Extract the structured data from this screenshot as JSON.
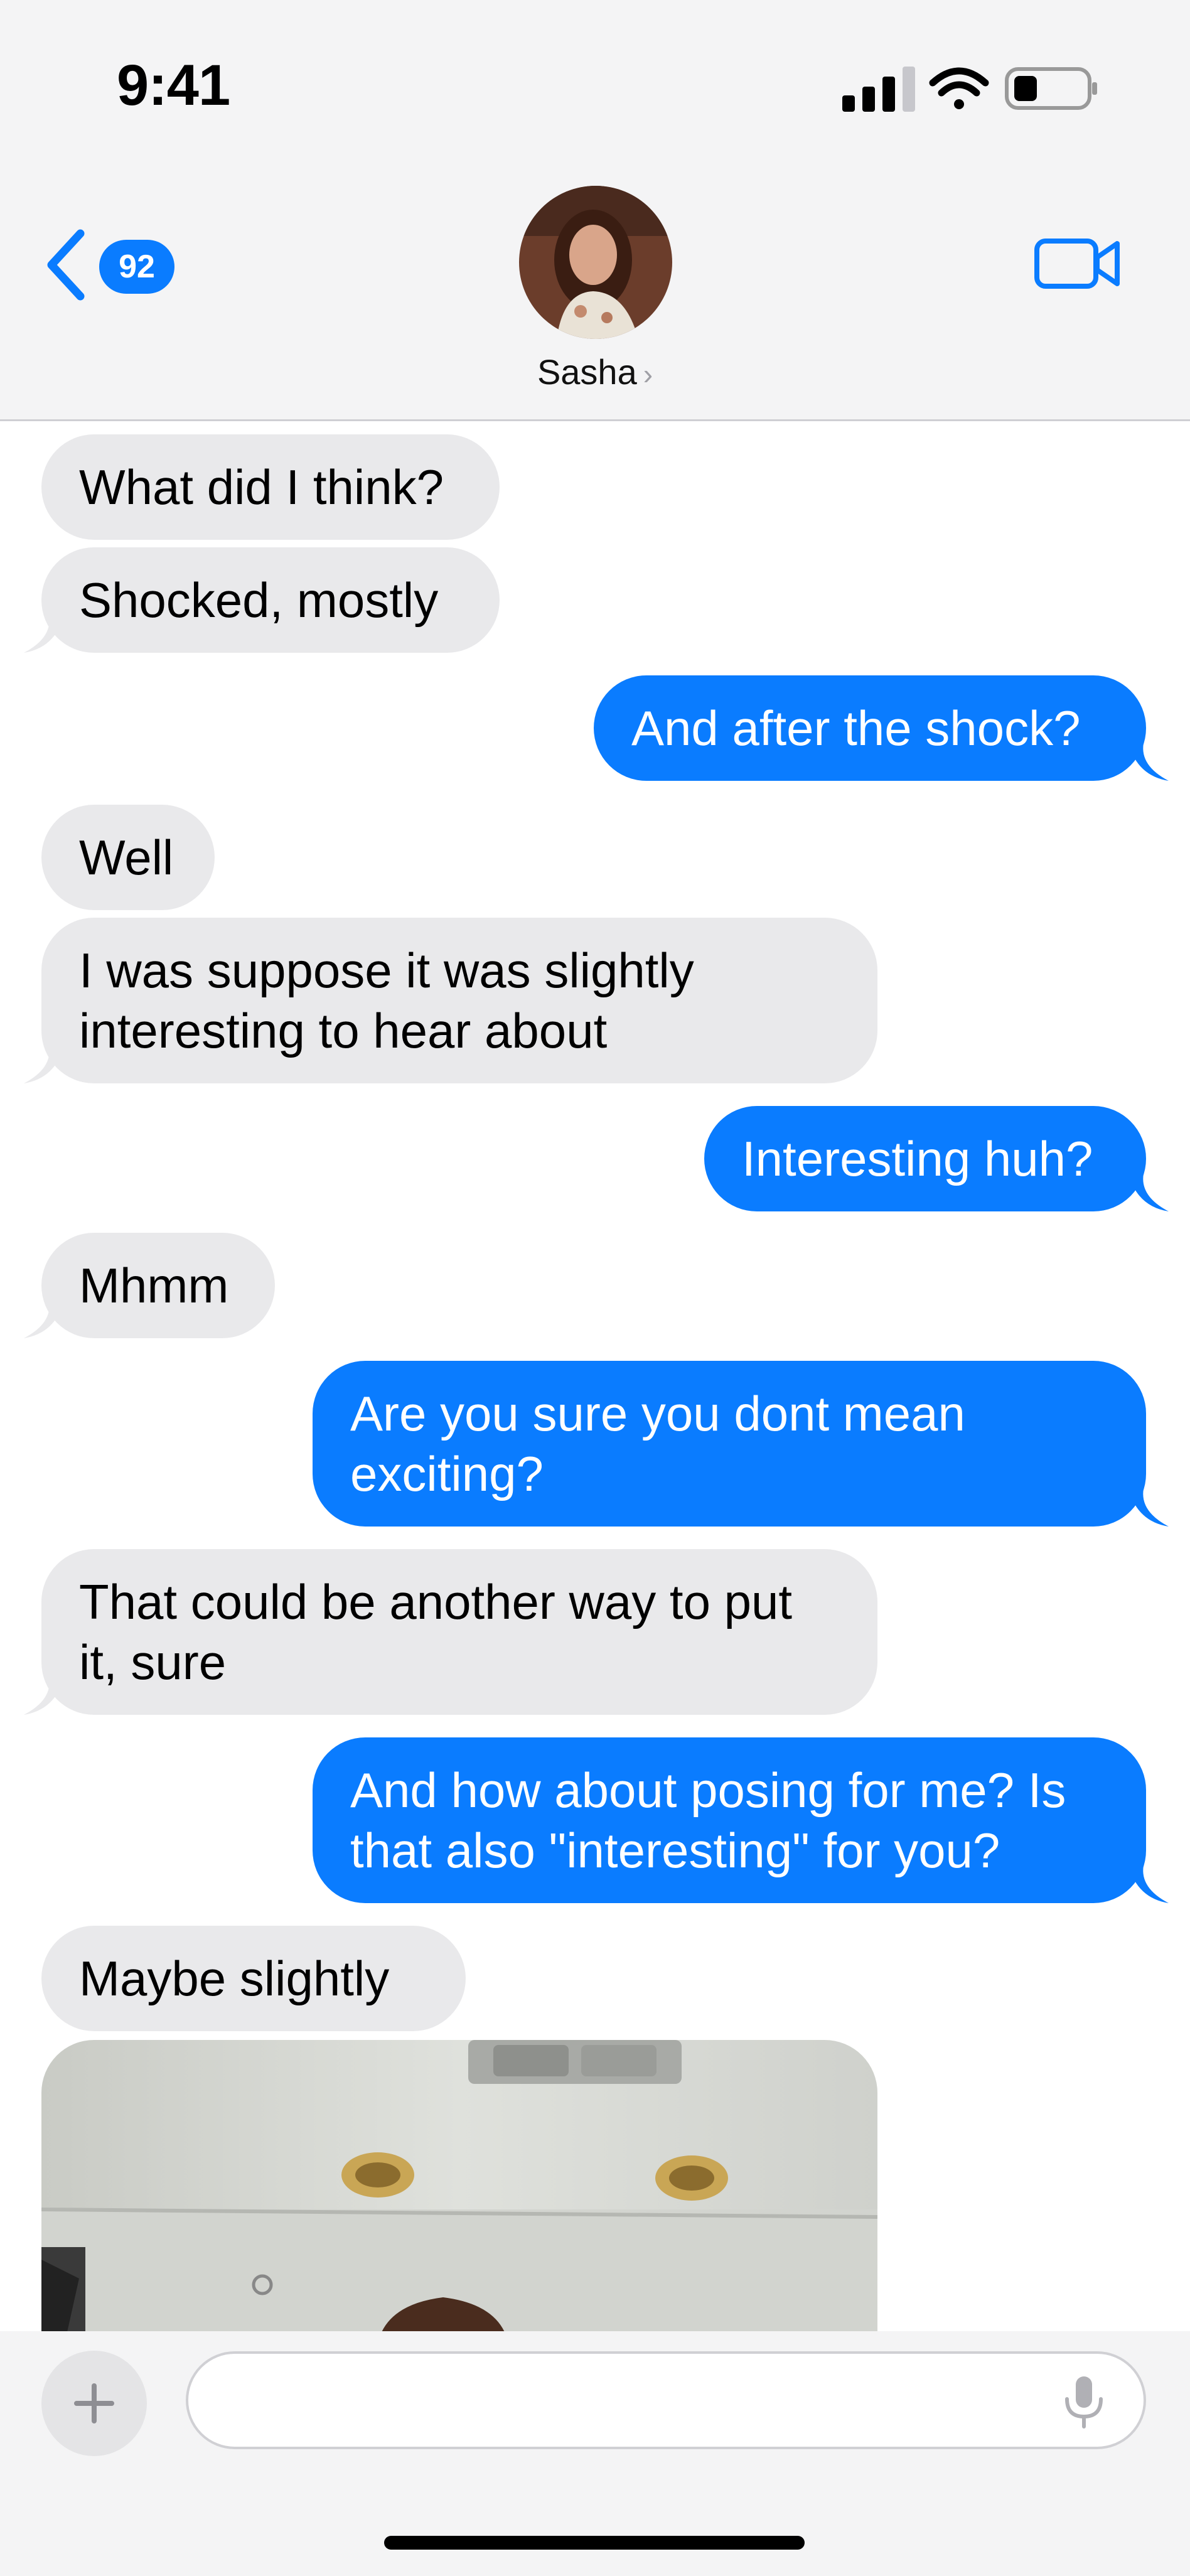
{
  "status_bar": {
    "time": "9:41"
  },
  "header": {
    "back_badge": "92",
    "contact_name": "Sasha",
    "icons": {
      "back": "chevron-left-icon",
      "video": "video-call-icon",
      "name_chevron": "chevron-right-icon"
    }
  },
  "messages": [
    {
      "direction": "received",
      "text": "What did I think?"
    },
    {
      "direction": "received",
      "text": "Shocked, mostly"
    },
    {
      "direction": "sent",
      "text": "And after the shock?"
    },
    {
      "direction": "received",
      "text": "Well"
    },
    {
      "direction": "received",
      "text": "I was suppose it was slightly interesting to hear about"
    },
    {
      "direction": "sent",
      "text": "Interesting huh?"
    },
    {
      "direction": "received",
      "text": "Mhmm"
    },
    {
      "direction": "sent",
      "text": "Are you sure you dont mean exciting?"
    },
    {
      "direction": "received",
      "text": "That could be another way to put it, sure"
    },
    {
      "direction": "sent",
      "text": "And how about posing for me? Is that also \"interesting\" for you?"
    },
    {
      "direction": "received",
      "text": "Maybe slightly"
    },
    {
      "direction": "received",
      "type": "photo"
    }
  ],
  "compose": {
    "placeholder": "",
    "icons": {
      "add": "plus-icon",
      "mic": "microphone-icon"
    }
  },
  "colors": {
    "sent_bubble": "#0a7cff",
    "received_bubble": "#e9e9eb",
    "accent": "#0a7cff"
  }
}
